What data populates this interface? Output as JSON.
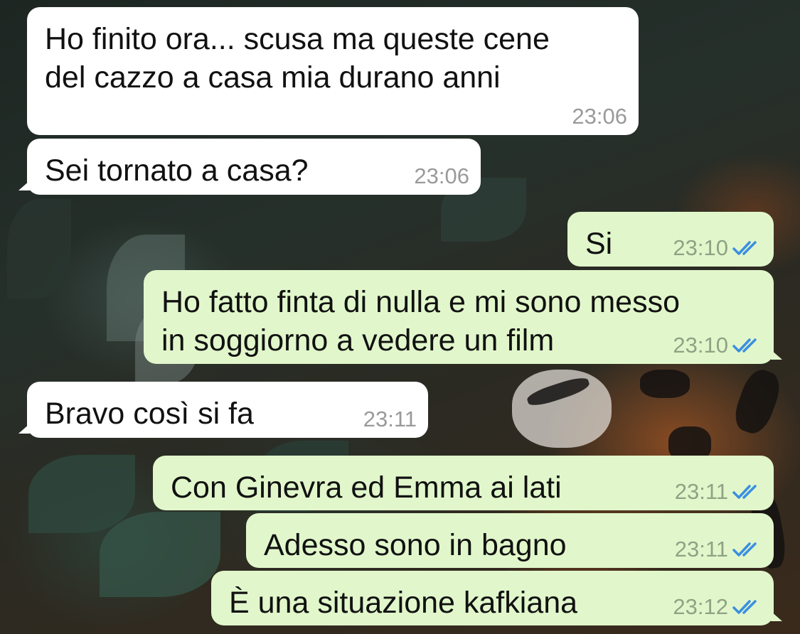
{
  "chat": {
    "messages": [
      {
        "direction": "in",
        "lines": [
          "Ho finito ora... scusa ma queste cene",
          "del cazzo a casa mia durano anni"
        ],
        "time": "23:06"
      },
      {
        "direction": "in",
        "lines": [
          "Sei tornato a casa?"
        ],
        "time": "23:06"
      },
      {
        "direction": "out",
        "lines": [
          "Si"
        ],
        "time": "23:10",
        "status_icon": "double-check-read-icon"
      },
      {
        "direction": "out",
        "lines": [
          "Ho fatto finta di nulla e mi sono messo",
          "in soggiorno a vedere un film"
        ],
        "time": "23:10",
        "status_icon": "double-check-read-icon"
      },
      {
        "direction": "in",
        "lines": [
          "Bravo così si fa"
        ],
        "time": "23:11"
      },
      {
        "direction": "out",
        "lines": [
          "Con Ginevra ed Emma ai lati"
        ],
        "time": "23:11",
        "status_icon": "double-check-read-icon"
      },
      {
        "direction": "out",
        "lines": [
          "Adesso sono in bagno"
        ],
        "time": "23:11",
        "status_icon": "double-check-read-icon"
      },
      {
        "direction": "out",
        "lines": [
          "È una situazione kafkiana"
        ],
        "time": "23:12",
        "status_icon": "double-check-read-icon"
      }
    ]
  },
  "colors": {
    "incoming_bubble": "#ffffff",
    "outgoing_bubble": "#e1f7cb",
    "timestamp": "#9a9a9a",
    "read_ticks": "#3b8fe0"
  }
}
